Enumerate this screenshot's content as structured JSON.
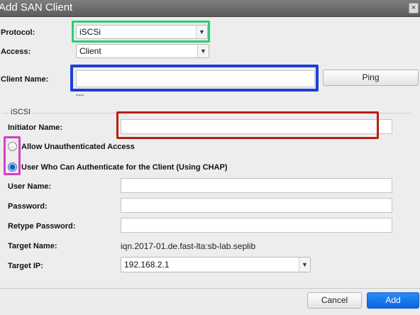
{
  "window": {
    "title": "Add SAN Client",
    "close_glyph": "×"
  },
  "form": {
    "protocol": {
      "label": "Protocol:",
      "value": "iSCSi"
    },
    "access": {
      "label": "Access:",
      "value": "Client"
    },
    "client_name": {
      "label": "Client Name:",
      "value": "",
      "hint": "---"
    },
    "ping_label": "Ping"
  },
  "iscsi": {
    "legend": "iSCSI",
    "initiator_name": {
      "label": "Initiator Name:",
      "value": ""
    },
    "auth_options": [
      {
        "label": "Allow Unauthenticated Access",
        "selected": false
      },
      {
        "label": "User Who Can Authenticate for the Client (Using CHAP)",
        "selected": true
      }
    ],
    "user_name": {
      "label": "User Name:",
      "value": ""
    },
    "password": {
      "label": "Password:",
      "value": ""
    },
    "retype_password": {
      "label": "Retype Password:",
      "value": ""
    },
    "target_name": {
      "label": "Target Name:",
      "value": "iqn.2017-01.de.fast-lta:sb-lab.seplib"
    },
    "target_ip": {
      "label": "Target IP:",
      "value": "192.168.2.1"
    }
  },
  "footer": {
    "cancel_label": "Cancel",
    "add_label": "Add"
  },
  "highlight_colors": {
    "protocol": "#2ecc71",
    "client_name": "#1f3fd6",
    "initiator": "#b8200e",
    "radios": "#d63fc3"
  }
}
